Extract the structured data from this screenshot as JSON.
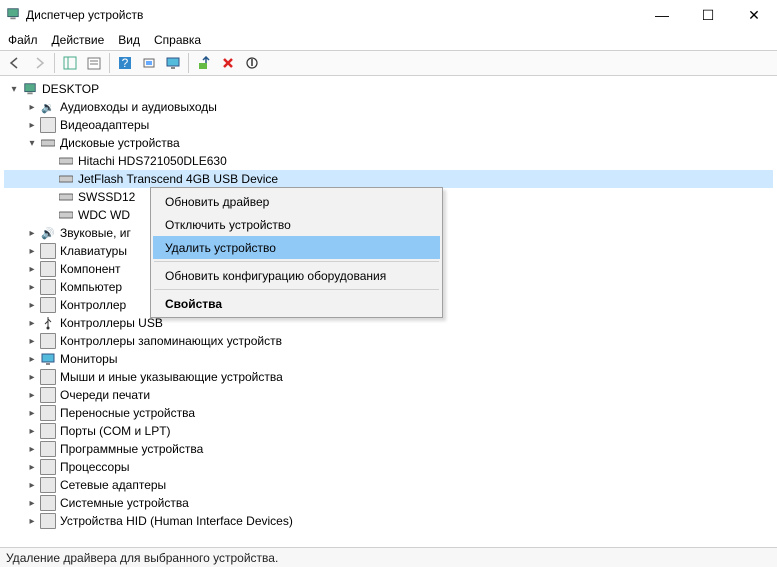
{
  "window": {
    "title": "Диспетчер устройств"
  },
  "menu": {
    "file": "Файл",
    "action": "Действие",
    "view": "Вид",
    "help": "Справка"
  },
  "root": "DESKTOP",
  "categories": {
    "audio": "Аудиовходы и аудиовыходы",
    "video": "Видеоадаптеры",
    "disk": "Дисковые устройства",
    "disk_items": {
      "d0": "Hitachi HDS721050DLE630",
      "d1": "JetFlash Transcend 4GB USB Device",
      "d2": "SWSSD12",
      "d3": "WDC WD"
    },
    "sound": "Звуковые, иг",
    "keyboard": "Клавиатуры",
    "components": "Компонент",
    "computer": "Компьютер",
    "controllers": "Контроллер",
    "usb": "Контроллеры USB",
    "storage_ctrl": "Контроллеры запоминающих устройств",
    "monitors": "Мониторы",
    "mice": "Мыши и иные указывающие устройства",
    "print_queues": "Очереди печати",
    "portable": "Переносные устройства",
    "ports": "Порты (COM и LPT)",
    "software_dev": "Программные устройства",
    "cpu": "Процессоры",
    "network": "Сетевые адаптеры",
    "system_dev": "Системные устройства",
    "hid": "Устройства HID (Human Interface Devices)"
  },
  "context": {
    "update_driver": "Обновить драйвер",
    "disable": "Отключить устройство",
    "uninstall": "Удалить устройство",
    "scan": "Обновить конфигурацию оборудования",
    "properties": "Свойства"
  },
  "status": "Удаление драйвера для выбранного устройства."
}
